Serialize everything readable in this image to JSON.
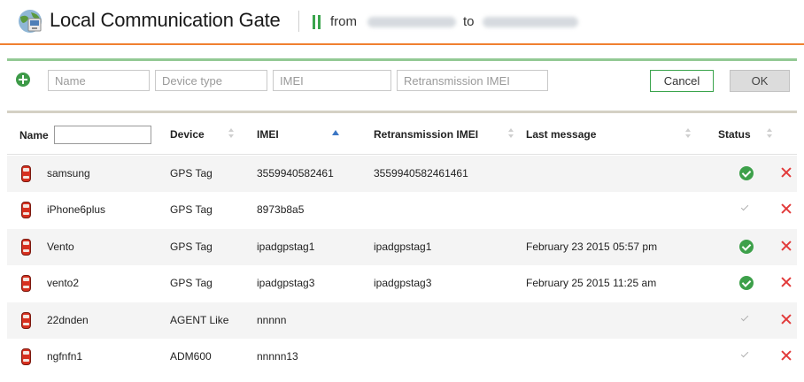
{
  "header": {
    "title": "Local Communication Gate",
    "from_label": "from",
    "to_label": "to",
    "accent_color": "#f08030"
  },
  "add_form": {
    "name_placeholder": "Name",
    "device_type_placeholder": "Device type",
    "imei_placeholder": "IMEI",
    "retransmission_imei_placeholder": "Retransmission IMEI",
    "cancel_label": "Cancel",
    "ok_label": "OK"
  },
  "table": {
    "columns": {
      "name": "Name",
      "device": "Device",
      "imei": "IMEI",
      "retransmission_imei": "Retransmission IMEI",
      "last_message": "Last message",
      "status": "Status"
    },
    "sorted_column": "IMEI",
    "sort_direction": "ascending",
    "rows": [
      {
        "name": "samsung",
        "device": "GPS Tag",
        "imei": "3559940582461",
        "retransmission_imei": "3559940582461461",
        "last_message": "",
        "status": "active"
      },
      {
        "name": "iPhone6plus",
        "device": "GPS Tag",
        "imei": "8973b8a5",
        "retransmission_imei": "",
        "last_message": "",
        "status": "inactive"
      },
      {
        "name": "Vento",
        "device": "GPS Tag",
        "imei": "ipadgpstag1",
        "retransmission_imei": "ipadgpstag1",
        "last_message": "February 23 2015 05:57 pm",
        "status": "active"
      },
      {
        "name": "vento2",
        "device": "GPS Tag",
        "imei": "ipadgpstag3",
        "retransmission_imei": "ipadgpstag3",
        "last_message": "February 25 2015 11:25 am",
        "status": "active"
      },
      {
        "name": "22dnden",
        "device": "AGENT Like",
        "imei": "nnnnn",
        "retransmission_imei": "",
        "last_message": "",
        "status": "inactive"
      },
      {
        "name": "ngfnfn1",
        "device": "ADM600",
        "imei": "nnnnn13",
        "retransmission_imei": "",
        "last_message": "",
        "status": "inactive"
      }
    ]
  },
  "icons": {
    "app": "globe-network-icon",
    "pause": "pause-icon",
    "add": "add-circle-icon",
    "unit": "car-icon",
    "status_active": "check-circle-icon",
    "status_inactive": "check-icon",
    "delete": "close-icon"
  }
}
